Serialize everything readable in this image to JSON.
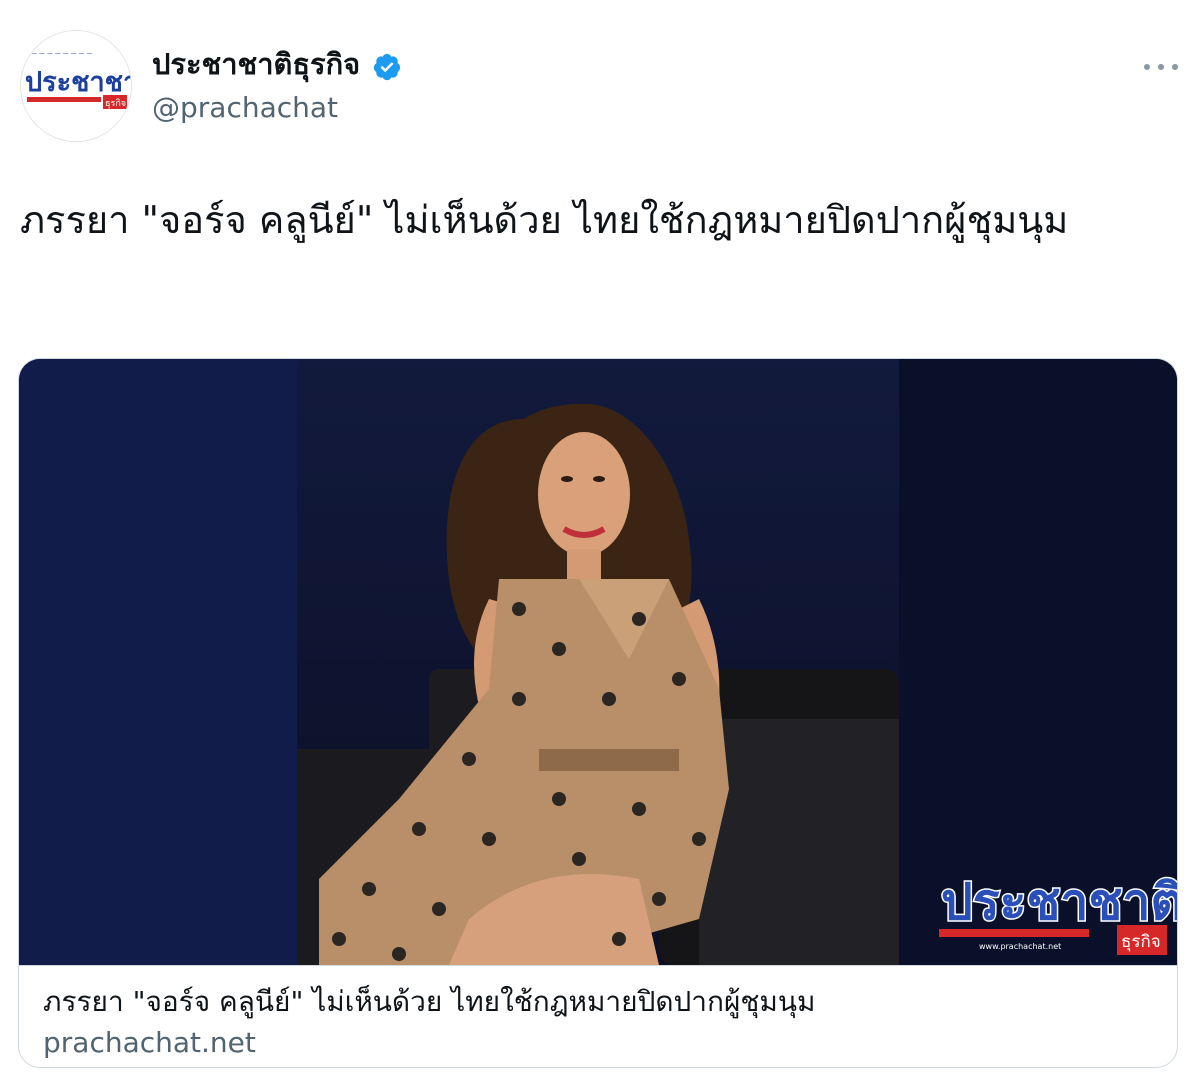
{
  "account": {
    "display_name": "ประชาชาติธุรกิจ",
    "handle": "@prachachat",
    "verified": true,
    "avatar_icon": "prachachat-logo-icon",
    "avatar_logo_text": "ประชาชาติ",
    "avatar_logo_subtext": "ธุรกิจ"
  },
  "menu": {
    "more_icon": "more-horizontal-icon"
  },
  "tweet": {
    "text": "ภรรยา \"จอร์จ คลูนีย์\" ไม่เห็นด้วย ไทยใช้กฎหมายปิดปากผู้ชุมนุม"
  },
  "card": {
    "image_watermark_text": "ประชาชาติ",
    "image_watermark_subtext": "ธุรกิจ",
    "image_watermark_url": "www.prachachat.net",
    "title": "ภรรยา \"จอร์จ คลูนีย์\" ไม่เห็นด้วย ไทยใช้กฎหมายปิดปากผู้ชุมนุม",
    "domain": "prachachat.net"
  },
  "colors": {
    "verified": "#1d9bf0",
    "logo_blue": "#1d3f9e",
    "logo_red": "#d62828",
    "muted_text": "#536471",
    "border": "#cfd9de"
  }
}
